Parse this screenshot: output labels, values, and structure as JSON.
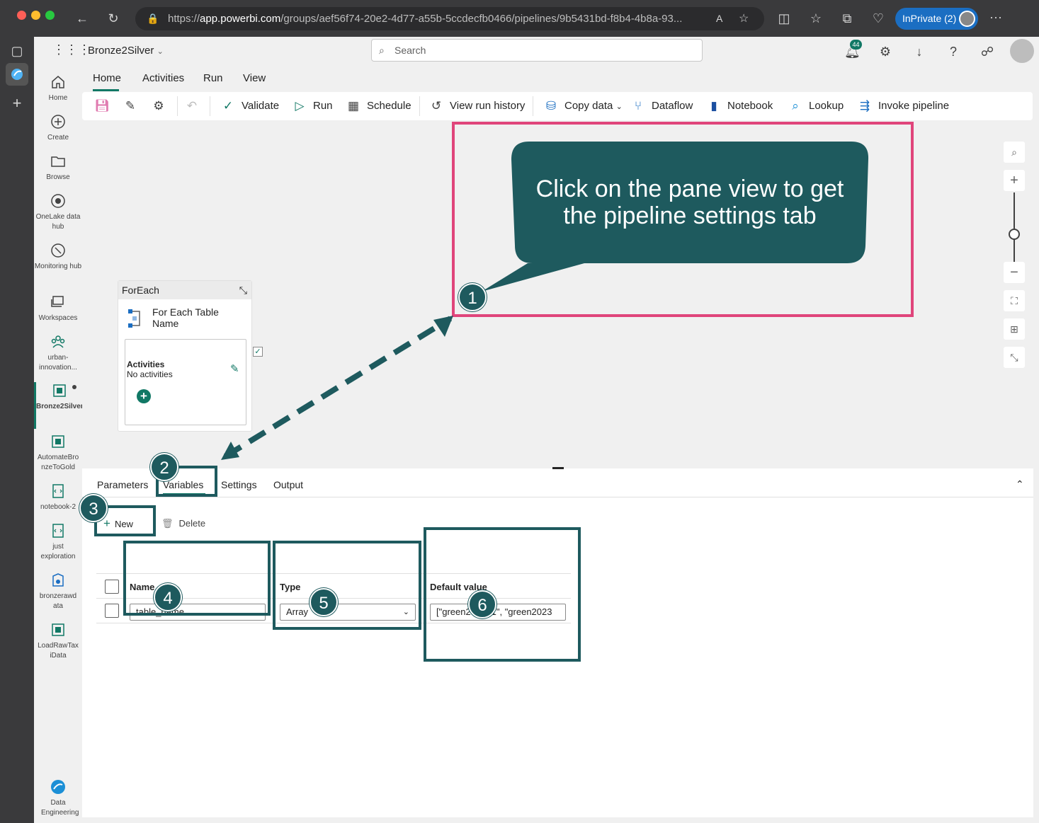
{
  "browser": {
    "url_prefix": "https://",
    "url_host": "app.powerbi.com",
    "url_path": "/groups/aef56f74-20e2-4d77-a55b-5ccdecfb0466/pipelines/9b5431bd-f8b4-4b8a-93...",
    "inprivate_label": "InPrivate (2)",
    "colors": {
      "close": "#fe5f57",
      "minimize": "#febc2e",
      "maximize": "#28c840",
      "inprivate": "#1b6ec2"
    }
  },
  "topbar": {
    "workspace_name": "Bronze2Silver",
    "search_placeholder": "Search",
    "notification_count": "44"
  },
  "leftnav": {
    "items": [
      {
        "label": "Home",
        "icon": "home-icon"
      },
      {
        "label": "Create",
        "icon": "plus-circle-icon"
      },
      {
        "label": "Browse",
        "icon": "folder-icon"
      },
      {
        "label": "OneLake data hub",
        "icon": "onelake-icon"
      },
      {
        "label": "Monitoring hub",
        "icon": "monitor-icon"
      },
      {
        "label": "Workspaces",
        "icon": "workspaces-icon"
      },
      {
        "label": "urban-innovation...",
        "icon": "group-icon"
      },
      {
        "label": "Bronze2Silver",
        "icon": "pipeline-icon"
      },
      {
        "label": "AutomateBronzeToGold",
        "icon": "pipeline-icon"
      },
      {
        "label": "notebook-2",
        "icon": "notebook-icon"
      },
      {
        "label": "just exploration",
        "icon": "notebook-icon"
      },
      {
        "label": "bronzerawdata",
        "icon": "lakehouse-icon"
      },
      {
        "label": "LoadRawTaxiData",
        "icon": "pipeline-icon"
      }
    ],
    "footer_label": "Data Engineering"
  },
  "ribbon": {
    "tabs": [
      "Home",
      "Activities",
      "Run",
      "View"
    ],
    "toolbar": {
      "validate": "Validate",
      "run": "Run",
      "schedule": "Schedule",
      "view_run_history": "View run history",
      "copy_data": "Copy data",
      "dataflow": "Dataflow",
      "notebook": "Notebook",
      "lookup": "Lookup",
      "invoke_pipeline": "Invoke pipeline"
    }
  },
  "canvas": {
    "foreach": {
      "header": "ForEach",
      "title": "For Each Table Name",
      "activities_label": "Activities",
      "activities_empty": "No activities"
    }
  },
  "bottom_panel": {
    "tabs": [
      "Parameters",
      "Variables",
      "Settings",
      "Output"
    ],
    "new_label": "New",
    "delete_label": "Delete",
    "columns": [
      "Name",
      "Type",
      "Default value"
    ],
    "rows": [
      {
        "name": "table_name",
        "type": "Array",
        "default_value": "[\"green201501\", \"green2023"
      }
    ]
  },
  "annotations": {
    "callout_text": "Click on the pane view to get the pipeline settings tab",
    "numbers": [
      "1",
      "2",
      "3",
      "4",
      "5",
      "6"
    ],
    "colors": {
      "callout": "#1e5a5e",
      "pink_box": "#e0457b"
    }
  }
}
